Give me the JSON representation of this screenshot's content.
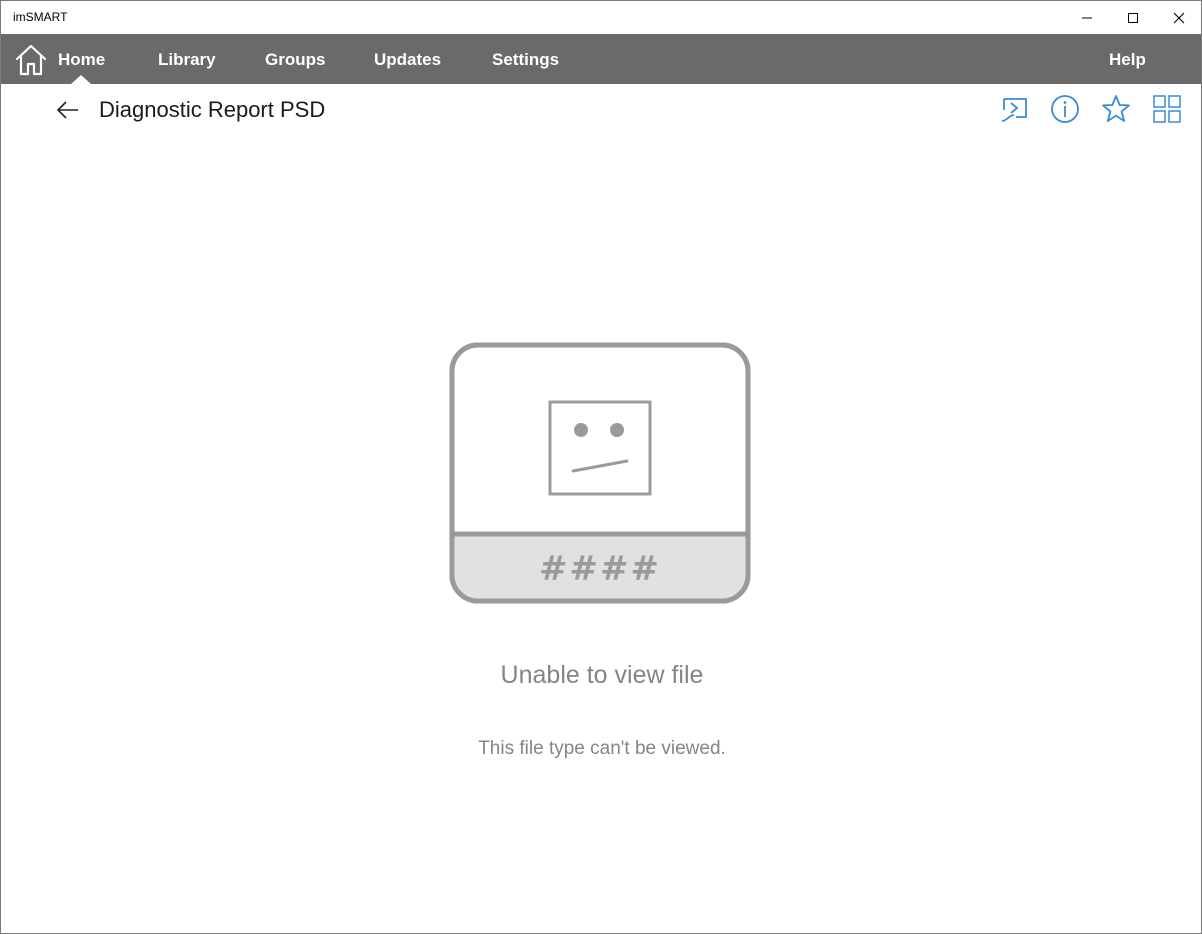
{
  "window": {
    "title": "imSMART"
  },
  "nav": {
    "items": [
      {
        "label": "Home"
      },
      {
        "label": "Library"
      },
      {
        "label": "Groups"
      },
      {
        "label": "Updates"
      },
      {
        "label": "Settings"
      }
    ],
    "help_label": "Help",
    "active": "Home",
    "home_icon": "home-icon"
  },
  "header": {
    "title": "Diagnostic Report PSD",
    "back_icon": "back-arrow-icon",
    "tools": [
      "present-icon",
      "info-icon",
      "star-icon",
      "grid-view-icon"
    ]
  },
  "content": {
    "placeholder_code": "####",
    "error_title": "Unable to view file",
    "error_message": "This file type can't be viewed."
  },
  "colors": {
    "navbar": "#6a6a6a",
    "accent": "#3a8ad8",
    "muted_text": "#858585",
    "placeholder_stroke": "#9a9a9a"
  }
}
